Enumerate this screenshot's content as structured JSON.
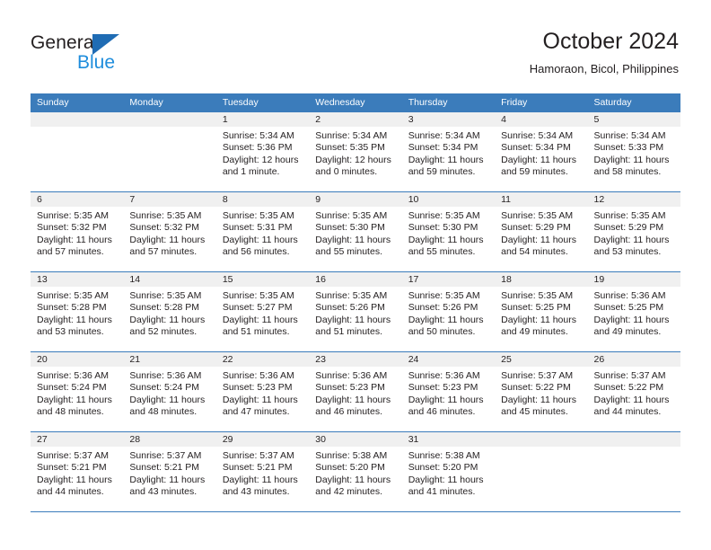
{
  "brand": {
    "name_top": "General",
    "name_bottom": "Blue",
    "triangle_color": "#1f6cb4",
    "blue_color": "#1f8ddc"
  },
  "header": {
    "title": "October 2024",
    "subtitle": "Hamoraon, Bicol, Philippines"
  },
  "theme": {
    "header_blue": "#3b7cbb",
    "band_gray": "#f0f0f0",
    "text": "#231f20"
  },
  "weekdays": [
    "Sunday",
    "Monday",
    "Tuesday",
    "Wednesday",
    "Thursday",
    "Friday",
    "Saturday"
  ],
  "weeks": [
    [
      {
        "day": "",
        "lines": []
      },
      {
        "day": "",
        "lines": []
      },
      {
        "day": "1",
        "lines": [
          "Sunrise: 5:34 AM",
          "Sunset: 5:36 PM",
          "Daylight: 12 hours",
          "and 1 minute."
        ]
      },
      {
        "day": "2",
        "lines": [
          "Sunrise: 5:34 AM",
          "Sunset: 5:35 PM",
          "Daylight: 12 hours",
          "and 0 minutes."
        ]
      },
      {
        "day": "3",
        "lines": [
          "Sunrise: 5:34 AM",
          "Sunset: 5:34 PM",
          "Daylight: 11 hours",
          "and 59 minutes."
        ]
      },
      {
        "day": "4",
        "lines": [
          "Sunrise: 5:34 AM",
          "Sunset: 5:34 PM",
          "Daylight: 11 hours",
          "and 59 minutes."
        ]
      },
      {
        "day": "5",
        "lines": [
          "Sunrise: 5:34 AM",
          "Sunset: 5:33 PM",
          "Daylight: 11 hours",
          "and 58 minutes."
        ]
      }
    ],
    [
      {
        "day": "6",
        "lines": [
          "Sunrise: 5:35 AM",
          "Sunset: 5:32 PM",
          "Daylight: 11 hours",
          "and 57 minutes."
        ]
      },
      {
        "day": "7",
        "lines": [
          "Sunrise: 5:35 AM",
          "Sunset: 5:32 PM",
          "Daylight: 11 hours",
          "and 57 minutes."
        ]
      },
      {
        "day": "8",
        "lines": [
          "Sunrise: 5:35 AM",
          "Sunset: 5:31 PM",
          "Daylight: 11 hours",
          "and 56 minutes."
        ]
      },
      {
        "day": "9",
        "lines": [
          "Sunrise: 5:35 AM",
          "Sunset: 5:30 PM",
          "Daylight: 11 hours",
          "and 55 minutes."
        ]
      },
      {
        "day": "10",
        "lines": [
          "Sunrise: 5:35 AM",
          "Sunset: 5:30 PM",
          "Daylight: 11 hours",
          "and 55 minutes."
        ]
      },
      {
        "day": "11",
        "lines": [
          "Sunrise: 5:35 AM",
          "Sunset: 5:29 PM",
          "Daylight: 11 hours",
          "and 54 minutes."
        ]
      },
      {
        "day": "12",
        "lines": [
          "Sunrise: 5:35 AM",
          "Sunset: 5:29 PM",
          "Daylight: 11 hours",
          "and 53 minutes."
        ]
      }
    ],
    [
      {
        "day": "13",
        "lines": [
          "Sunrise: 5:35 AM",
          "Sunset: 5:28 PM",
          "Daylight: 11 hours",
          "and 53 minutes."
        ]
      },
      {
        "day": "14",
        "lines": [
          "Sunrise: 5:35 AM",
          "Sunset: 5:28 PM",
          "Daylight: 11 hours",
          "and 52 minutes."
        ]
      },
      {
        "day": "15",
        "lines": [
          "Sunrise: 5:35 AM",
          "Sunset: 5:27 PM",
          "Daylight: 11 hours",
          "and 51 minutes."
        ]
      },
      {
        "day": "16",
        "lines": [
          "Sunrise: 5:35 AM",
          "Sunset: 5:26 PM",
          "Daylight: 11 hours",
          "and 51 minutes."
        ]
      },
      {
        "day": "17",
        "lines": [
          "Sunrise: 5:35 AM",
          "Sunset: 5:26 PM",
          "Daylight: 11 hours",
          "and 50 minutes."
        ]
      },
      {
        "day": "18",
        "lines": [
          "Sunrise: 5:35 AM",
          "Sunset: 5:25 PM",
          "Daylight: 11 hours",
          "and 49 minutes."
        ]
      },
      {
        "day": "19",
        "lines": [
          "Sunrise: 5:36 AM",
          "Sunset: 5:25 PM",
          "Daylight: 11 hours",
          "and 49 minutes."
        ]
      }
    ],
    [
      {
        "day": "20",
        "lines": [
          "Sunrise: 5:36 AM",
          "Sunset: 5:24 PM",
          "Daylight: 11 hours",
          "and 48 minutes."
        ]
      },
      {
        "day": "21",
        "lines": [
          "Sunrise: 5:36 AM",
          "Sunset: 5:24 PM",
          "Daylight: 11 hours",
          "and 48 minutes."
        ]
      },
      {
        "day": "22",
        "lines": [
          "Sunrise: 5:36 AM",
          "Sunset: 5:23 PM",
          "Daylight: 11 hours",
          "and 47 minutes."
        ]
      },
      {
        "day": "23",
        "lines": [
          "Sunrise: 5:36 AM",
          "Sunset: 5:23 PM",
          "Daylight: 11 hours",
          "and 46 minutes."
        ]
      },
      {
        "day": "24",
        "lines": [
          "Sunrise: 5:36 AM",
          "Sunset: 5:23 PM",
          "Daylight: 11 hours",
          "and 46 minutes."
        ]
      },
      {
        "day": "25",
        "lines": [
          "Sunrise: 5:37 AM",
          "Sunset: 5:22 PM",
          "Daylight: 11 hours",
          "and 45 minutes."
        ]
      },
      {
        "day": "26",
        "lines": [
          "Sunrise: 5:37 AM",
          "Sunset: 5:22 PM",
          "Daylight: 11 hours",
          "and 44 minutes."
        ]
      }
    ],
    [
      {
        "day": "27",
        "lines": [
          "Sunrise: 5:37 AM",
          "Sunset: 5:21 PM",
          "Daylight: 11 hours",
          "and 44 minutes."
        ]
      },
      {
        "day": "28",
        "lines": [
          "Sunrise: 5:37 AM",
          "Sunset: 5:21 PM",
          "Daylight: 11 hours",
          "and 43 minutes."
        ]
      },
      {
        "day": "29",
        "lines": [
          "Sunrise: 5:37 AM",
          "Sunset: 5:21 PM",
          "Daylight: 11 hours",
          "and 43 minutes."
        ]
      },
      {
        "day": "30",
        "lines": [
          "Sunrise: 5:38 AM",
          "Sunset: 5:20 PM",
          "Daylight: 11 hours",
          "and 42 minutes."
        ]
      },
      {
        "day": "31",
        "lines": [
          "Sunrise: 5:38 AM",
          "Sunset: 5:20 PM",
          "Daylight: 11 hours",
          "and 41 minutes."
        ]
      },
      {
        "day": "",
        "lines": []
      },
      {
        "day": "",
        "lines": []
      }
    ]
  ]
}
